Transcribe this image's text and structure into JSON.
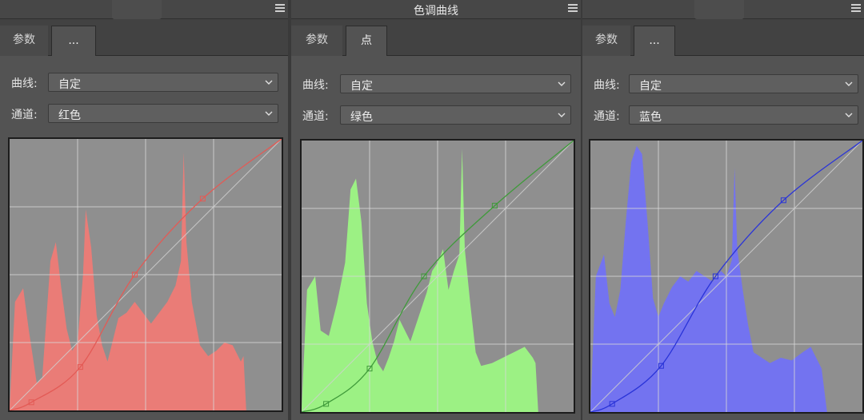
{
  "panels": [
    {
      "title": "",
      "tabs": {
        "params": "参数",
        "point": "..."
      },
      "curve_label": "曲线:",
      "curve_value": "自定",
      "channel_label": "通道:",
      "channel_value": "红色",
      "color": "#e35a55",
      "hist_color": "#ef7b76",
      "points": [
        [
          0,
          0
        ],
        [
          0.08,
          0.03
        ],
        [
          0.26,
          0.16
        ],
        [
          0.46,
          0.5
        ],
        [
          0.71,
          0.78
        ],
        [
          1,
          1
        ]
      ]
    },
    {
      "title": "色调曲线",
      "tabs": {
        "params": "参数",
        "point": "点"
      },
      "curve_label": "曲线:",
      "curve_value": "自定",
      "channel_label": "通道:",
      "channel_value": "绿色",
      "color": "#3f9a3a",
      "hist_color": "#9df784",
      "points": [
        [
          0,
          0
        ],
        [
          0.09,
          0.03
        ],
        [
          0.25,
          0.16
        ],
        [
          0.45,
          0.5
        ],
        [
          0.71,
          0.76
        ],
        [
          1,
          1
        ]
      ]
    },
    {
      "title": "",
      "tabs": {
        "params": "参数",
        "point": "..."
      },
      "curve_label": "曲线:",
      "curve_value": "自定",
      "channel_label": "通道:",
      "channel_value": "蓝色",
      "color": "#2a34d8",
      "hist_color": "#7272f6",
      "points": [
        [
          0,
          0
        ],
        [
          0.08,
          0.03
        ],
        [
          0.26,
          0.17
        ],
        [
          0.46,
          0.5
        ],
        [
          0.71,
          0.78
        ],
        [
          1,
          1
        ]
      ]
    }
  ]
}
